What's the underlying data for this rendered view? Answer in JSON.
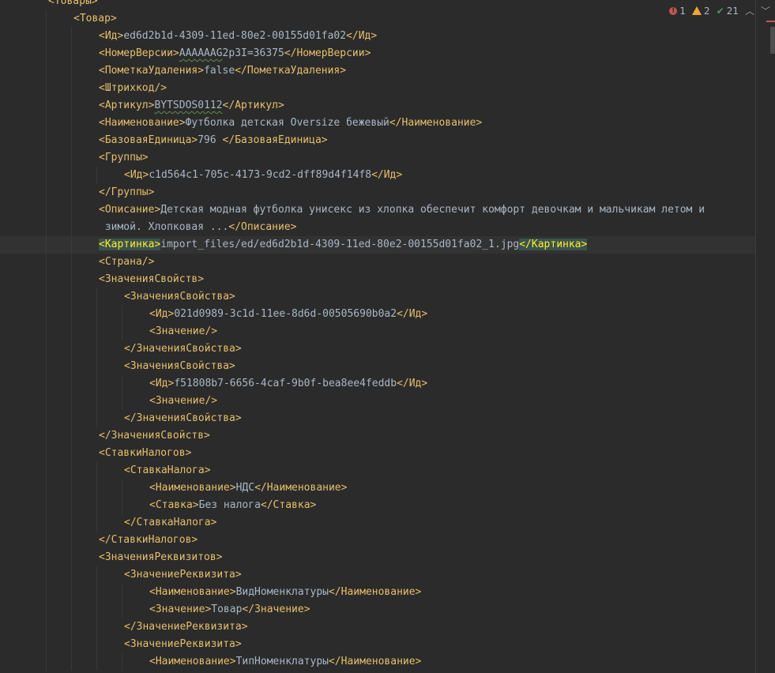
{
  "status": {
    "errors": "1",
    "warnings": "2",
    "ok": "21",
    "prev_icon": "chevron-up-icon",
    "next_icon": "chevron-down-icon"
  },
  "colors": {
    "background": "#2b2b2b",
    "tag": "#e8bf6a",
    "text": "#a9b7c6",
    "error": "#c75450",
    "warning": "#f0a732",
    "ok": "#499c54"
  },
  "lines": [
    {
      "indent": 1,
      "parts": [
        [
          "t",
          "<Товары>"
        ]
      ]
    },
    {
      "indent": 2,
      "parts": [
        [
          "t",
          "<Товар>"
        ]
      ]
    },
    {
      "indent": 3,
      "parts": [
        [
          "t",
          "<Ид>"
        ],
        [
          "v",
          "ed6d2b1d-4309-11ed-80e2-00155d01fa02"
        ],
        [
          "t",
          "</Ид>"
        ]
      ]
    },
    {
      "indent": 3,
      "parts": [
        [
          "t",
          "<НомерВерсии>"
        ],
        [
          "s",
          "AAAAAAG"
        ],
        [
          "v",
          "2p3I=36375"
        ],
        [
          "t",
          "</НомерВерсии>"
        ]
      ]
    },
    {
      "indent": 3,
      "parts": [
        [
          "t",
          "<ПометкаУдаления>"
        ],
        [
          "v",
          "false"
        ],
        [
          "t",
          "</ПометкаУдаления>"
        ]
      ]
    },
    {
      "indent": 3,
      "parts": [
        [
          "t",
          "<Штрихкод/>"
        ]
      ]
    },
    {
      "indent": 3,
      "parts": [
        [
          "t",
          "<Артикул>"
        ],
        [
          "s",
          "BYTSDOS0112"
        ],
        [
          "t",
          "</Артикул>"
        ]
      ]
    },
    {
      "indent": 3,
      "parts": [
        [
          "t",
          "<Наименование>"
        ],
        [
          "v",
          "Футболка детская Oversize бежевый"
        ],
        [
          "t",
          "</Наименование>"
        ]
      ]
    },
    {
      "indent": 3,
      "parts": [
        [
          "t",
          "<БазоваяЕдиница>"
        ],
        [
          "v",
          "796 "
        ],
        [
          "t",
          "</БазоваяЕдиница>"
        ]
      ]
    },
    {
      "indent": 3,
      "parts": [
        [
          "t",
          "<Группы>"
        ]
      ]
    },
    {
      "indent": 4,
      "parts": [
        [
          "t",
          "<Ид>"
        ],
        [
          "v",
          "c1d564c1-705c-4173-9cd2-dff89d4f14f8"
        ],
        [
          "t",
          "</Ид>"
        ]
      ]
    },
    {
      "indent": 3,
      "parts": [
        [
          "t",
          "</Группы>"
        ]
      ]
    },
    {
      "indent": 3,
      "parts": [
        [
          "t",
          "<Описание>"
        ],
        [
          "v",
          "Детская модная футболка унисекс из хлопка обеспечит комфорт девочкам и мальчикам летом и"
        ]
      ]
    },
    {
      "indent": 3,
      "parts": [
        [
          "v",
          " зимой. Хлопковая ..."
        ],
        [
          "t",
          "</Описание>"
        ]
      ]
    },
    {
      "indent": 3,
      "current": true,
      "parts": [
        [
          "m",
          "<Картинка>"
        ],
        [
          "v",
          "import_files/ed/ed6d2b1d-4309-11ed-80e2-00155d01fa02_1.jpg"
        ],
        [
          "m",
          "</Картинка>"
        ]
      ]
    },
    {
      "indent": 3,
      "parts": [
        [
          "t",
          "<Страна/>"
        ]
      ]
    },
    {
      "indent": 3,
      "parts": [
        [
          "t",
          "<ЗначенияСвойств>"
        ]
      ]
    },
    {
      "indent": 4,
      "parts": [
        [
          "t",
          "<ЗначенияСвойства>"
        ]
      ]
    },
    {
      "indent": 5,
      "parts": [
        [
          "t",
          "<Ид>"
        ],
        [
          "v",
          "021d0989-3c1d-11ee-8d6d-00505690b0a2"
        ],
        [
          "t",
          "</Ид>"
        ]
      ]
    },
    {
      "indent": 5,
      "parts": [
        [
          "t",
          "<Значение/>"
        ]
      ]
    },
    {
      "indent": 4,
      "parts": [
        [
          "t",
          "</ЗначенияСвойства>"
        ]
      ]
    },
    {
      "indent": 4,
      "parts": [
        [
          "t",
          "<ЗначенияСвойства>"
        ]
      ]
    },
    {
      "indent": 5,
      "parts": [
        [
          "t",
          "<Ид>"
        ],
        [
          "v",
          "f51808b7-6656-4caf-9b0f-bea8ee4feddb"
        ],
        [
          "t",
          "</Ид>"
        ]
      ]
    },
    {
      "indent": 5,
      "parts": [
        [
          "t",
          "<Значение/>"
        ]
      ]
    },
    {
      "indent": 4,
      "parts": [
        [
          "t",
          "</ЗначенияСвойства>"
        ]
      ]
    },
    {
      "indent": 3,
      "parts": [
        [
          "t",
          "</ЗначенияСвойств>"
        ]
      ]
    },
    {
      "indent": 3,
      "parts": [
        [
          "t",
          "<СтавкиНалогов>"
        ]
      ]
    },
    {
      "indent": 4,
      "parts": [
        [
          "t",
          "<СтавкаНалога>"
        ]
      ]
    },
    {
      "indent": 5,
      "parts": [
        [
          "t",
          "<Наименование>"
        ],
        [
          "v",
          "НДС"
        ],
        [
          "t",
          "</Наименование>"
        ]
      ]
    },
    {
      "indent": 5,
      "parts": [
        [
          "t",
          "<Ставка>"
        ],
        [
          "v",
          "Без налога"
        ],
        [
          "t",
          "</Ставка>"
        ]
      ]
    },
    {
      "indent": 4,
      "parts": [
        [
          "t",
          "</СтавкаНалога>"
        ]
      ]
    },
    {
      "indent": 3,
      "parts": [
        [
          "t",
          "</СтавкиНалогов>"
        ]
      ]
    },
    {
      "indent": 3,
      "parts": [
        [
          "t",
          "<ЗначенияРеквизитов>"
        ]
      ]
    },
    {
      "indent": 4,
      "parts": [
        [
          "t",
          "<ЗначениеРеквизита>"
        ]
      ]
    },
    {
      "indent": 5,
      "parts": [
        [
          "t",
          "<Наименование>"
        ],
        [
          "v",
          "ВидНоменклатуры"
        ],
        [
          "t",
          "</Наименование>"
        ]
      ]
    },
    {
      "indent": 5,
      "parts": [
        [
          "t",
          "<Значение>"
        ],
        [
          "v",
          "Товар"
        ],
        [
          "t",
          "</Значение>"
        ]
      ]
    },
    {
      "indent": 4,
      "parts": [
        [
          "t",
          "</ЗначениеРеквизита>"
        ]
      ]
    },
    {
      "indent": 4,
      "parts": [
        [
          "t",
          "<ЗначениеРеквизита>"
        ]
      ]
    },
    {
      "indent": 5,
      "parts": [
        [
          "t",
          "<Наименование>"
        ],
        [
          "v",
          "ТипНоменклатуры"
        ],
        [
          "t",
          "</Наименование>"
        ]
      ]
    }
  ]
}
